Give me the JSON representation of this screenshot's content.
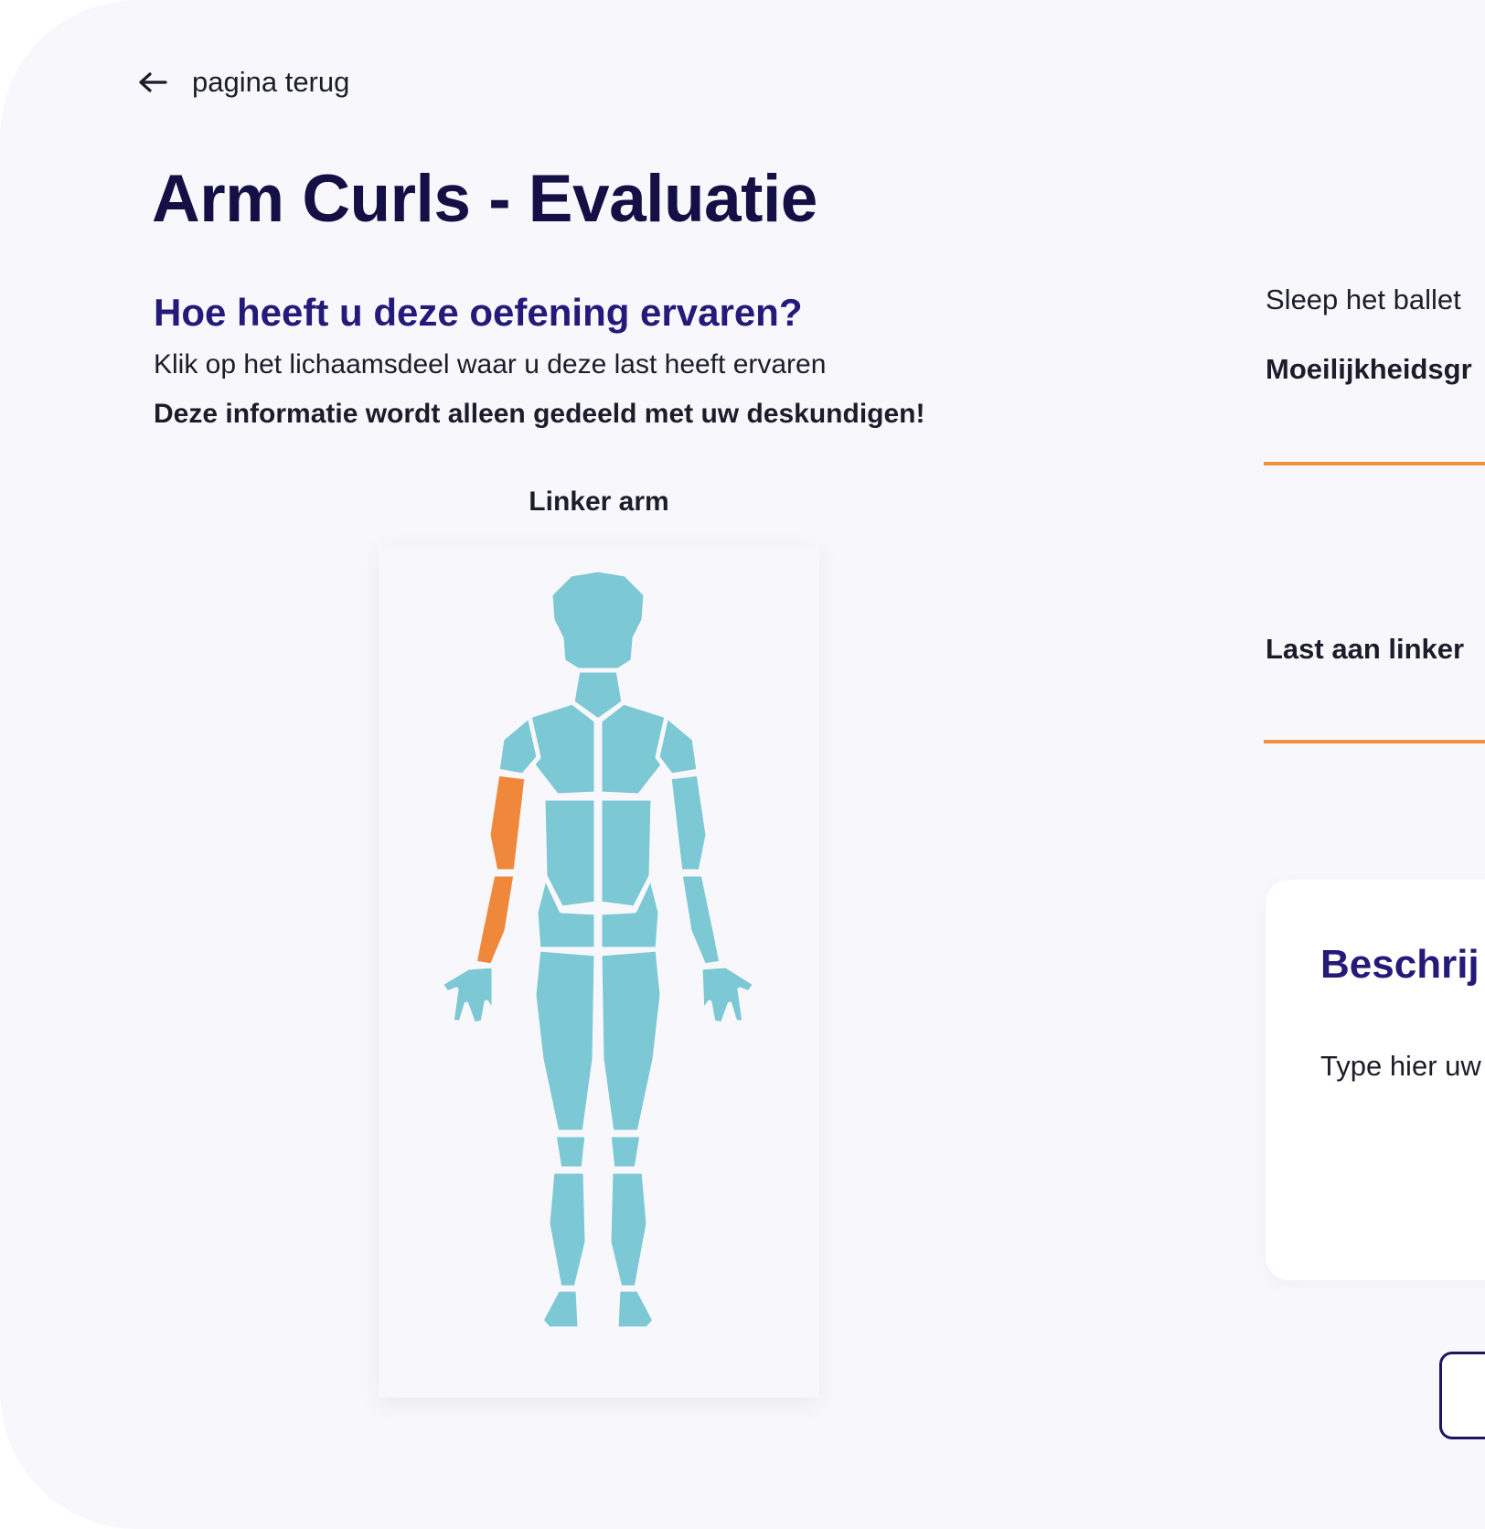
{
  "nav": {
    "back_label": "pagina terug"
  },
  "page": {
    "title": "Arm Curls - Evaluatie",
    "subtitle": "Hoe heeft u deze oefening ervaren?",
    "instruction": "Klik op het lichaamsdeel waar u deze last heeft ervaren",
    "notice": "Deze informatie wordt alleen gedeeld met uw deskundigen!"
  },
  "body_map": {
    "selected_part_label": "Linker arm",
    "base_color": "#7cc8d4",
    "highlight_color": "#f0883c"
  },
  "right_panel": {
    "drag_instruction": "Sleep het ballet",
    "difficulty_label": "Moeilijkheidsgr",
    "discomfort_label": "Last aan linker",
    "slider_color": "#f0903a"
  },
  "description_card": {
    "title": "Beschrij",
    "placeholder": "Type hier uw"
  }
}
